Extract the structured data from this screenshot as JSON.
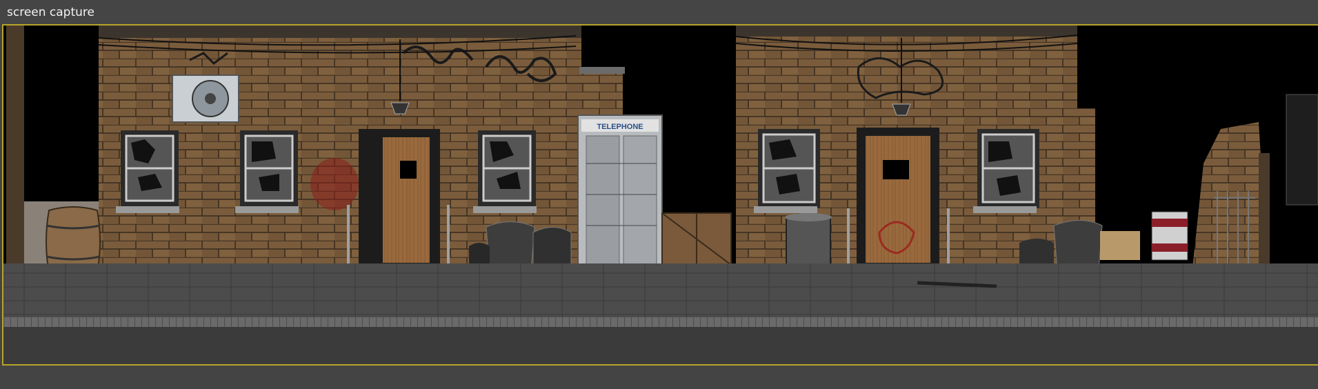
{
  "window": {
    "title": "screen capture"
  },
  "scene": {
    "booth_sign": "TELEPHONE",
    "colors": {
      "viewport_border": "#b8a52a",
      "brick": "#6e5336",
      "mortar": "#3a2c1f",
      "door_wood": "#9a6a3e",
      "sidewalk": "#4a4a4a",
      "graffiti": "#1a1a1a",
      "blood": "#8a1f1a"
    }
  }
}
